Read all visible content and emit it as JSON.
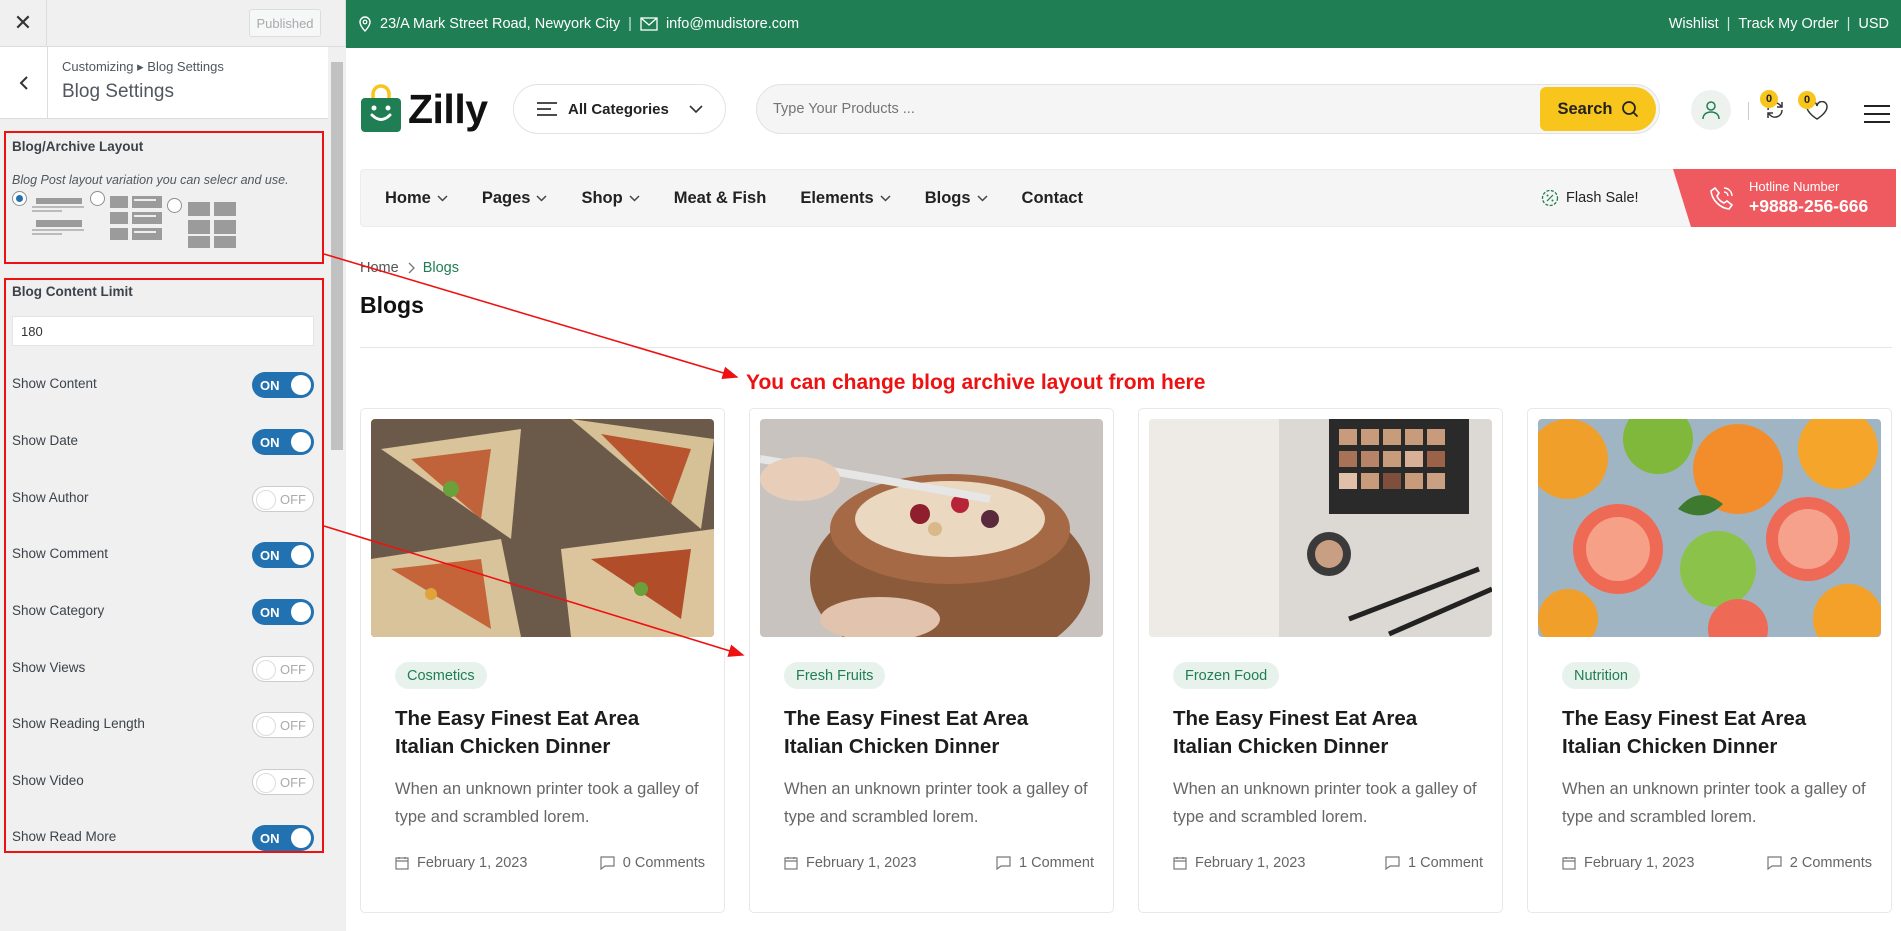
{
  "customizer": {
    "close_icon": "close-icon",
    "published_label": "Published",
    "breadcrumb": "Customizing ▸ Blog Settings",
    "title": "Blog Settings",
    "layout_section": {
      "label": "Blog/Archive Layout",
      "description": "Blog Post layout variation you can selecr and use.",
      "options": [
        "list",
        "grid-2",
        "grid-3"
      ],
      "selected": "list"
    },
    "content_limit": {
      "label": "Blog Content Limit",
      "value": "180"
    },
    "toggles": [
      {
        "label": "Show Content",
        "state": "ON"
      },
      {
        "label": "Show Date",
        "state": "ON"
      },
      {
        "label": "Show Author",
        "state": "OFF"
      },
      {
        "label": "Show Comment",
        "state": "ON"
      },
      {
        "label": "Show Category",
        "state": "ON"
      },
      {
        "label": "Show Views",
        "state": "OFF"
      },
      {
        "label": "Show Reading Length",
        "state": "OFF"
      },
      {
        "label": "Show Video",
        "state": "OFF"
      },
      {
        "label": "Show Read More",
        "state": "ON"
      }
    ]
  },
  "site": {
    "topbar": {
      "address": "23/A Mark Street Road, Newyork City",
      "email": "info@mudistore.com",
      "links": [
        "Wishlist",
        "Track My Order",
        "USD"
      ]
    },
    "logo": "Zilly",
    "category_button": "All Categories",
    "search_placeholder": "Type Your Products ...",
    "search_button": "Search",
    "compare_count": "0",
    "wishlist_count": "0",
    "nav": [
      "Home",
      "Pages",
      "Shop",
      "Meat & Fish",
      "Elements",
      "Blogs",
      "Contact"
    ],
    "flash_sale": "Flash Sale!",
    "hotline_label": "Hotline Number",
    "hotline_number": "+9888-256-666",
    "breadcrumb": [
      "Home",
      "Blogs"
    ],
    "page_title": "Blogs",
    "annotation": "You can change blog archive layout from here",
    "posts": [
      {
        "tag": "Cosmetics",
        "title": "The Easy Finest Eat Area Italian Chicken Dinner",
        "excerpt": "When an unknown printer took a galley of type and scrambled lorem.",
        "date": "February 1, 2023",
        "comments": "0 Comments"
      },
      {
        "tag": "Fresh Fruits",
        "title": "The Easy Finest Eat Area Italian Chicken Dinner",
        "excerpt": "When an unknown printer took a galley of type and scrambled lorem.",
        "date": "February 1, 2023",
        "comments": "1 Comment"
      },
      {
        "tag": "Frozen Food",
        "title": "The Easy Finest Eat Area Italian Chicken Dinner",
        "excerpt": "When an unknown printer took a galley of type and scrambled lorem.",
        "date": "February 1, 2023",
        "comments": "1 Comment"
      },
      {
        "tag": "Nutrition",
        "title": "The Easy Finest Eat Area Italian Chicken Dinner",
        "excerpt": "When an unknown printer took a galley of type and scrambled lorem.",
        "date": "February 1, 2023",
        "comments": "2 Comments"
      }
    ]
  },
  "colors": {
    "brand_green": "#1f7e53",
    "accent_yellow": "#f8c51c",
    "hotline_red": "#ee5a5f",
    "toggle_blue": "#2271b1",
    "annotation_red": "#e11111"
  }
}
